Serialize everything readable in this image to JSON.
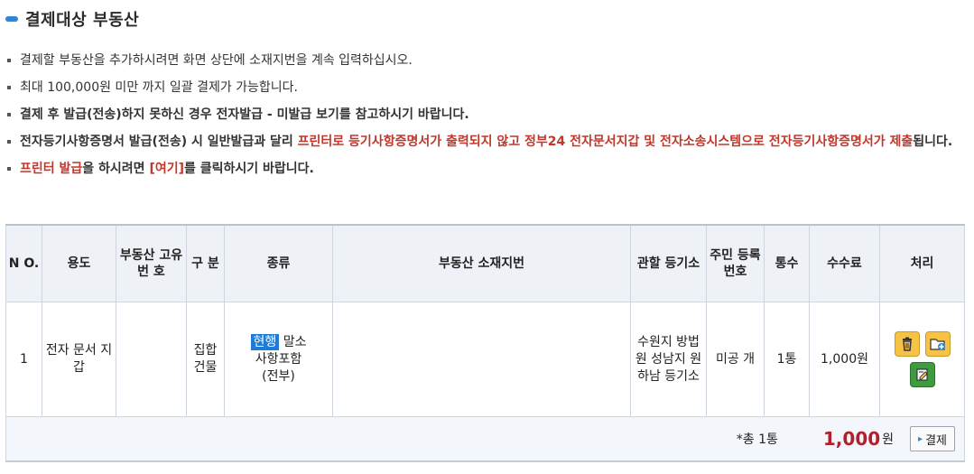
{
  "section": {
    "title": "결제대상 부동산"
  },
  "notes": [
    "결제할 부동산을 추가하시려면 화면 상단에 소재지번을 계속 입력하십시오.",
    "최대 100,000원 미만 까지 일괄 결제가 가능합니다.",
    "결제 후 발급(전송)하지 못하신 경우 전자발급 - 미발급 보기를 참고하시기 바랍니다."
  ],
  "note4": {
    "part1": "전자등기사항증명서 발급(전송) 시 일반발급과 달리 ",
    "part2": "프린터로 등기사항증명서가 출력되지 않고 정부24 전자문서지갑 및 전자소송시스템으로 전자등기사항증명서가 제출",
    "part3": "됩니다."
  },
  "note5": {
    "part1": "프린터 발급",
    "part2": "을 하시려면 ",
    "part3": "[여기]",
    "part4": "를 클릭하시기 바랍니다."
  },
  "table": {
    "headers": {
      "no": "N O.",
      "usage": "용도",
      "unique_no": "부동산 고유번 호",
      "division": "구 분",
      "kind": "종류",
      "address": "부동산 소재지번",
      "registry": "관할 등기소",
      "resident_no": "주민 등록 번호",
      "copies": "통수",
      "fee": "수수료",
      "action": "처리"
    },
    "row": {
      "no": "1",
      "usage": "전자 문서 지갑",
      "unique_no": "",
      "division": "집합 건물",
      "kind_badge": "현행",
      "kind_text1": " 말소",
      "kind_text2": "사항포함",
      "kind_text3": "(전부)",
      "address": "",
      "registry": "수원지 방법원 성남지 원 하남 등기소",
      "resident_no": "미공 개",
      "copies": "1통",
      "fee": "1,000원"
    },
    "icons": [
      "trash-icon",
      "folder-add-icon",
      "edit-icon"
    ],
    "footer": {
      "count": "*총 1통",
      "amount": "1,000",
      "unit": "원",
      "pay_button": "결제"
    }
  },
  "colors": {
    "accent": "#2a86d8",
    "red": "#c0372c",
    "badge": "#1e7bd7",
    "amount": "#b21f2d"
  }
}
